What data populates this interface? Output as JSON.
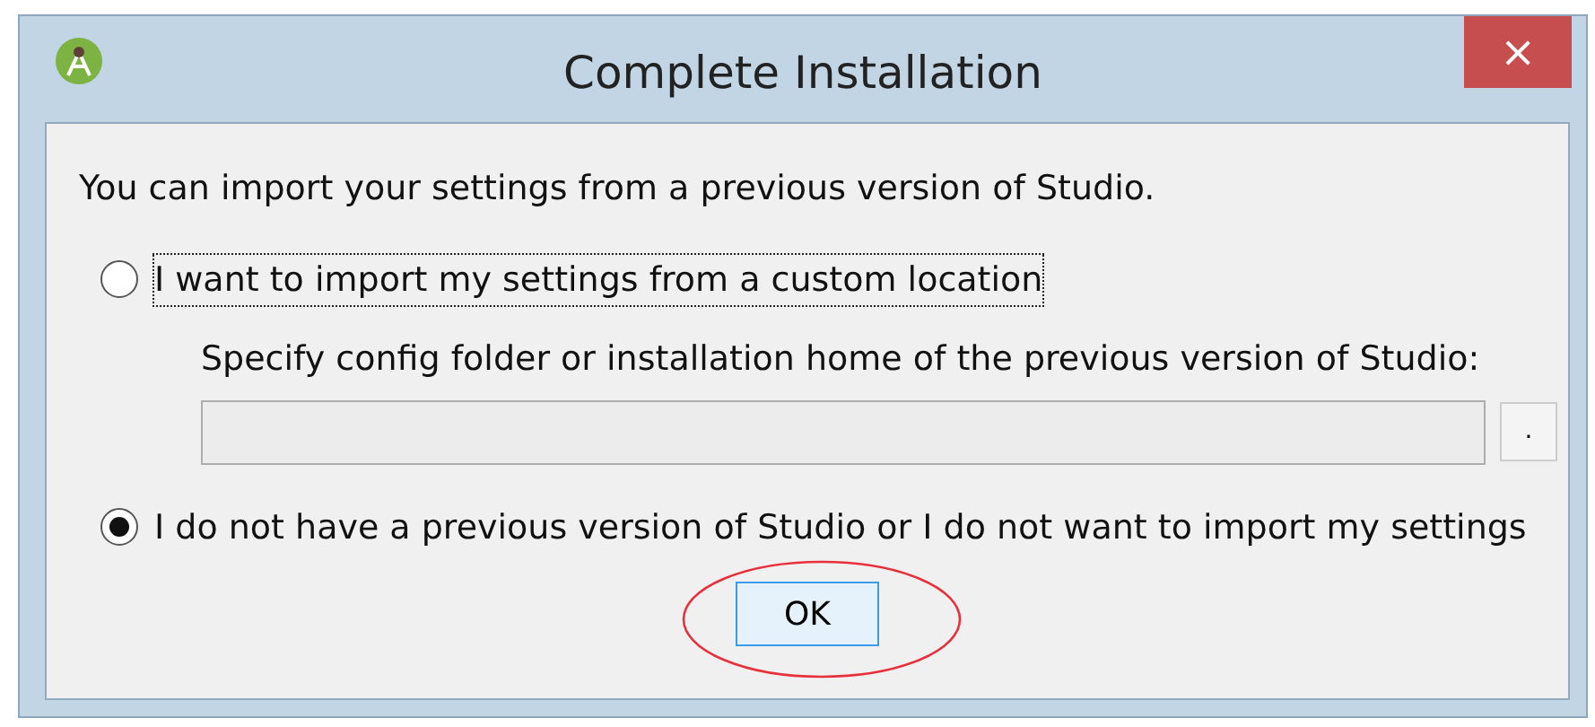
{
  "window": {
    "title": "Complete Installation",
    "close": "×"
  },
  "intro": "You can import your settings from a previous version of Studio.",
  "options": [
    {
      "label": "I want to import my settings from a custom location",
      "selected": false,
      "focused": true
    },
    {
      "label": "I do not have a previous version of Studio or I do not want to import my settings",
      "selected": true,
      "focused": false
    }
  ],
  "path": {
    "label": "Specify config folder or installation home of the previous version of Studio:",
    "disabled": true,
    "browse": "."
  },
  "ok_button": {
    "label": "OK",
    "circled": true
  }
}
